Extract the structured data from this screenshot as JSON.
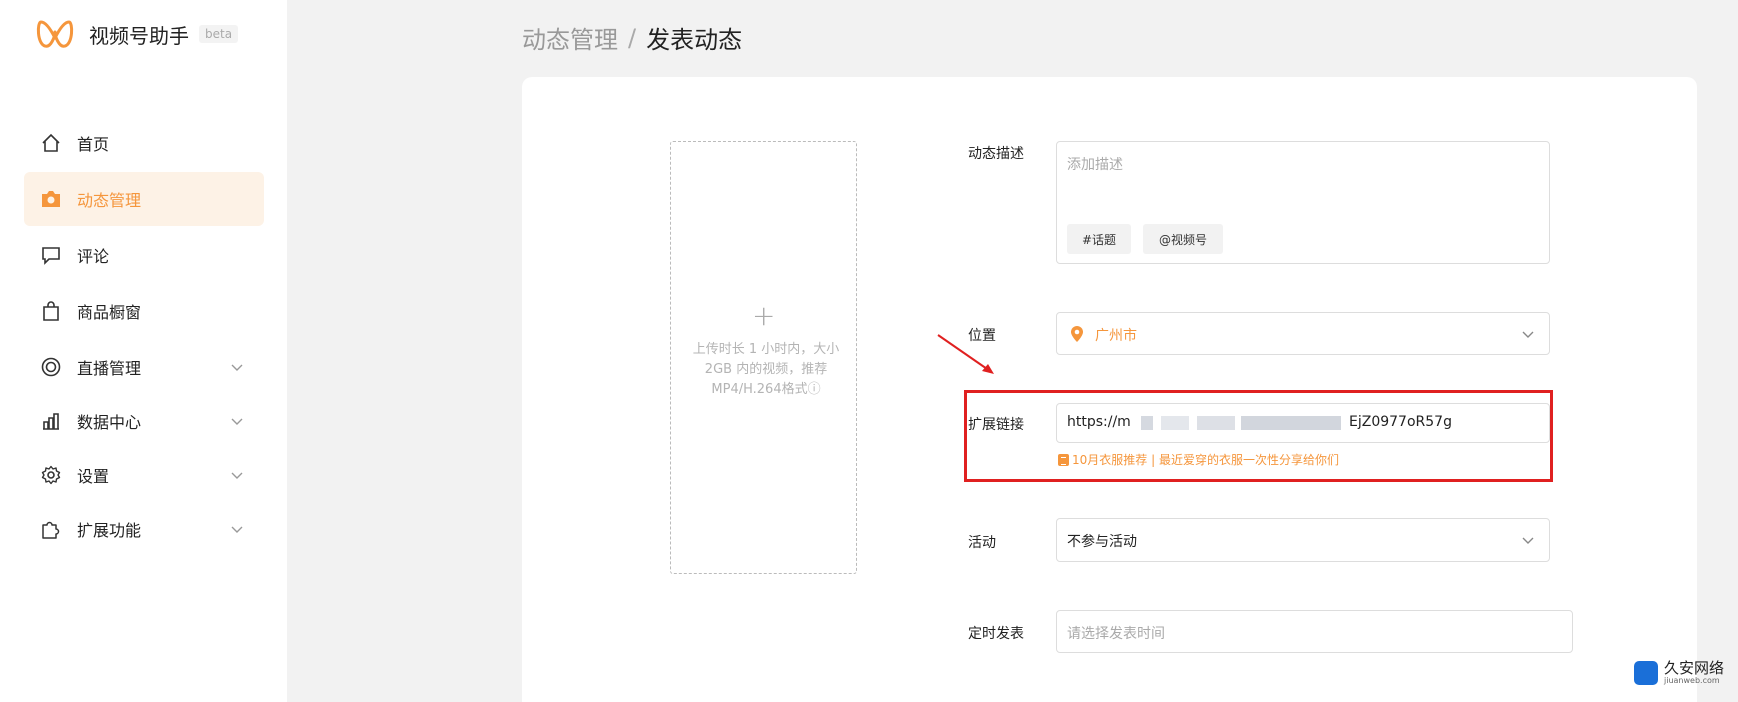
{
  "app": {
    "name": "视频号助手",
    "badge": "beta"
  },
  "sidebar": {
    "items": [
      {
        "label": "首页",
        "icon": "home-icon",
        "active": false
      },
      {
        "label": "动态管理",
        "icon": "camera-icon",
        "active": true
      },
      {
        "label": "评论",
        "icon": "comment-icon",
        "active": false
      },
      {
        "label": "商品橱窗",
        "icon": "shopping-bag-icon",
        "active": false
      },
      {
        "label": "直播管理",
        "icon": "live-icon",
        "active": false,
        "expandable": true
      },
      {
        "label": "数据中心",
        "icon": "bar-chart-icon",
        "active": false,
        "expandable": true
      },
      {
        "label": "设置",
        "icon": "gear-icon",
        "active": false,
        "expandable": true
      },
      {
        "label": "扩展功能",
        "icon": "puzzle-icon",
        "active": false,
        "expandable": true
      }
    ]
  },
  "breadcrumb": {
    "parent": "动态管理",
    "separator": "/",
    "current": "发表动态"
  },
  "upload": {
    "plus": "+",
    "hint": "上传时长 1 小时内，大小 2GB 内的视频，推荐MP4/H.264格式ⓘ"
  },
  "form": {
    "description": {
      "label": "动态描述",
      "placeholder": "添加描述",
      "topic_chip": "#话题",
      "mention_chip": "@视频号"
    },
    "location": {
      "label": "位置",
      "value": "广州市"
    },
    "link": {
      "label": "扩展链接",
      "value_start": "https://m",
      "value_end": "EjZ0977oR57g",
      "recommendation": "10月衣服推荐 | 最近爱穿的衣服一次性分享给你们"
    },
    "activity": {
      "label": "活动",
      "value": "不参与活动"
    },
    "schedule": {
      "label": "定时发表",
      "placeholder": "请选择发表时间"
    }
  },
  "watermark": {
    "title": "久安网络",
    "subtitle": "jiuanweb.com"
  },
  "colors": {
    "accent": "#f5963c",
    "highlight": "#e02020",
    "active_bg": "#fdf2e6"
  }
}
